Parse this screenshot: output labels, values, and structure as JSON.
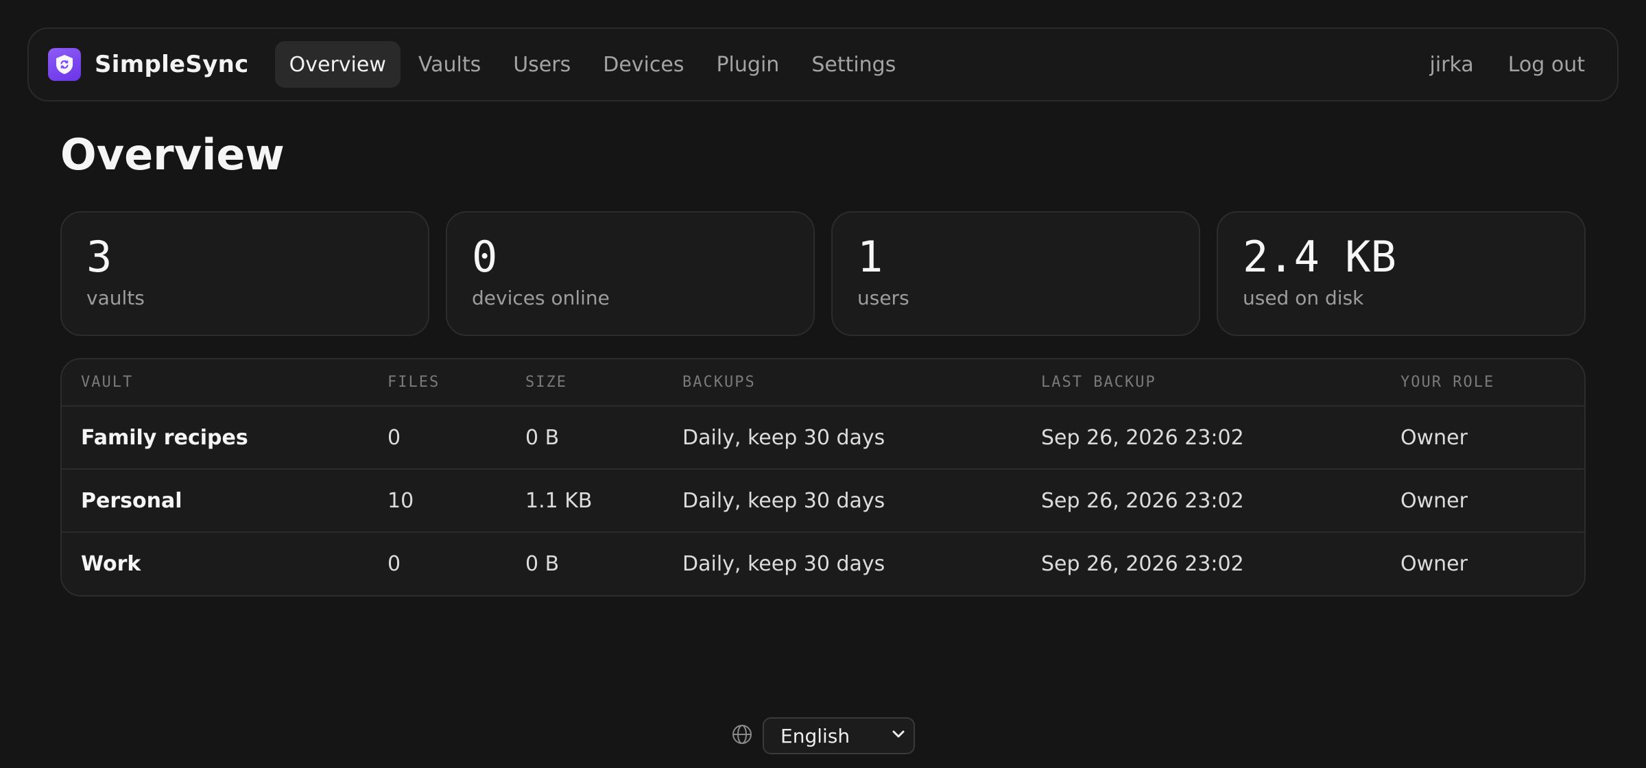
{
  "brand": {
    "name": "SimpleSync",
    "logo_icon": "shield-sync-icon",
    "accent": "#7c4dff"
  },
  "nav": {
    "links": [
      {
        "label": "Overview",
        "active": true
      },
      {
        "label": "Vaults",
        "active": false
      },
      {
        "label": "Users",
        "active": false
      },
      {
        "label": "Devices",
        "active": false
      },
      {
        "label": "Plugin",
        "active": false
      },
      {
        "label": "Settings",
        "active": false
      }
    ],
    "user": "jirka",
    "logout": "Log out"
  },
  "page": {
    "title": "Overview"
  },
  "stats": [
    {
      "value": "3",
      "label": "vaults"
    },
    {
      "value": "0",
      "label": "devices online"
    },
    {
      "value": "1",
      "label": "users"
    },
    {
      "value": "2.4 KB",
      "label": "used on disk"
    }
  ],
  "table": {
    "headers": [
      "VAULT",
      "FILES",
      "SIZE",
      "BACKUPS",
      "LAST BACKUP",
      "YOUR ROLE"
    ],
    "rows": [
      [
        "Family recipes",
        "0",
        "0 B",
        "Daily, keep 30 days",
        "Sep 26, 2026 23:02",
        "Owner"
      ],
      [
        "Personal",
        "10",
        "1.1 KB",
        "Daily, keep 30 days",
        "Sep 26, 2026 23:02",
        "Owner"
      ],
      [
        "Work",
        "0",
        "0 B",
        "Daily, keep 30 days",
        "Sep 26, 2026 23:02",
        "Owner"
      ]
    ]
  },
  "footer": {
    "language_icon": "globe-icon",
    "language": "English"
  }
}
